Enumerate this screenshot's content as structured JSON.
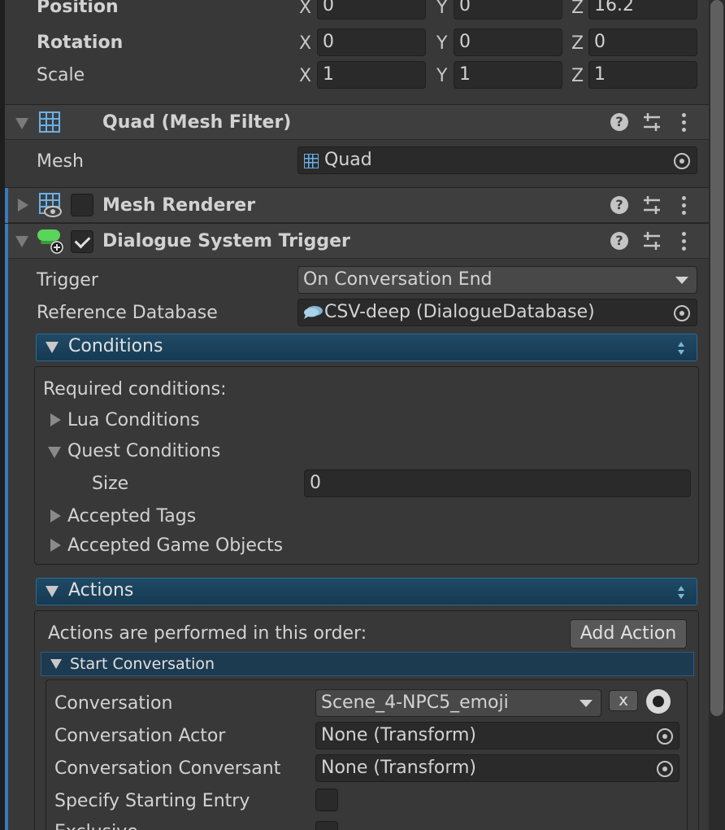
{
  "transform": {
    "position": {
      "label": "Position",
      "x": "0",
      "y": "0",
      "z": "16.2"
    },
    "rotation": {
      "label": "Rotation",
      "x": "0",
      "y": "0",
      "z": "0"
    },
    "scale": {
      "label": "Scale",
      "x": "1",
      "y": "1",
      "z": "1"
    },
    "axis_x": "X",
    "axis_y": "Y",
    "axis_z": "Z"
  },
  "mesh_filter": {
    "title": "Quad (Mesh Filter)",
    "mesh_label": "Mesh",
    "mesh_value": "Quad"
  },
  "mesh_renderer": {
    "title": "Mesh Renderer",
    "enabled": false
  },
  "dialogue_trigger": {
    "title": "Dialogue System Trigger",
    "enabled": true,
    "trigger_label": "Trigger",
    "trigger_value": "On Conversation End",
    "ref_db_label": "Reference Database",
    "ref_db_value": "CSV-deep (DialogueDatabase)"
  },
  "conditions": {
    "header": "Conditions",
    "required_label": "Required conditions:",
    "lua_conditions": "Lua Conditions",
    "quest_conditions": "Quest Conditions",
    "size_label": "Size",
    "size_value": "0",
    "accepted_tags": "Accepted Tags",
    "accepted_game_objects": "Accepted Game Objects"
  },
  "actions": {
    "header": "Actions",
    "order_text": "Actions are performed in this order:",
    "add_action": "Add Action",
    "start_conversation": "Start Conversation",
    "conversation_label": "Conversation",
    "conversation_value": "Scene_4-NPC5_emoji",
    "clear_button": "x",
    "actor_label": "Conversation Actor",
    "actor_value": "None (Transform)",
    "conversant_label": "Conversation Conversant",
    "conversant_value": "None (Transform)",
    "specify_entry_label": "Specify Starting Entry",
    "specify_entry_checked": false,
    "exclusive_label": "Exclusive"
  },
  "colors": {
    "panel_bg": "#383838",
    "header_bg": "#3e3e3e",
    "section_header": "#1f4a66",
    "accent_blue": "#3a79bb",
    "icon_blue": "#6ab0e8",
    "dialogue_green": "#5bd45b"
  },
  "icons": {
    "fold": "triangle-fold-icon",
    "mesh": "grid-mesh-icon",
    "renderer": "mesh-renderer-eye-icon",
    "dialogue": "dialogue-trigger-green-icon",
    "help": "question-mark-icon",
    "presets": "sliders-icon",
    "menu": "kebab-menu-icon",
    "object_picker": "target-circle-icon",
    "database": "speech-bubble-icon"
  }
}
